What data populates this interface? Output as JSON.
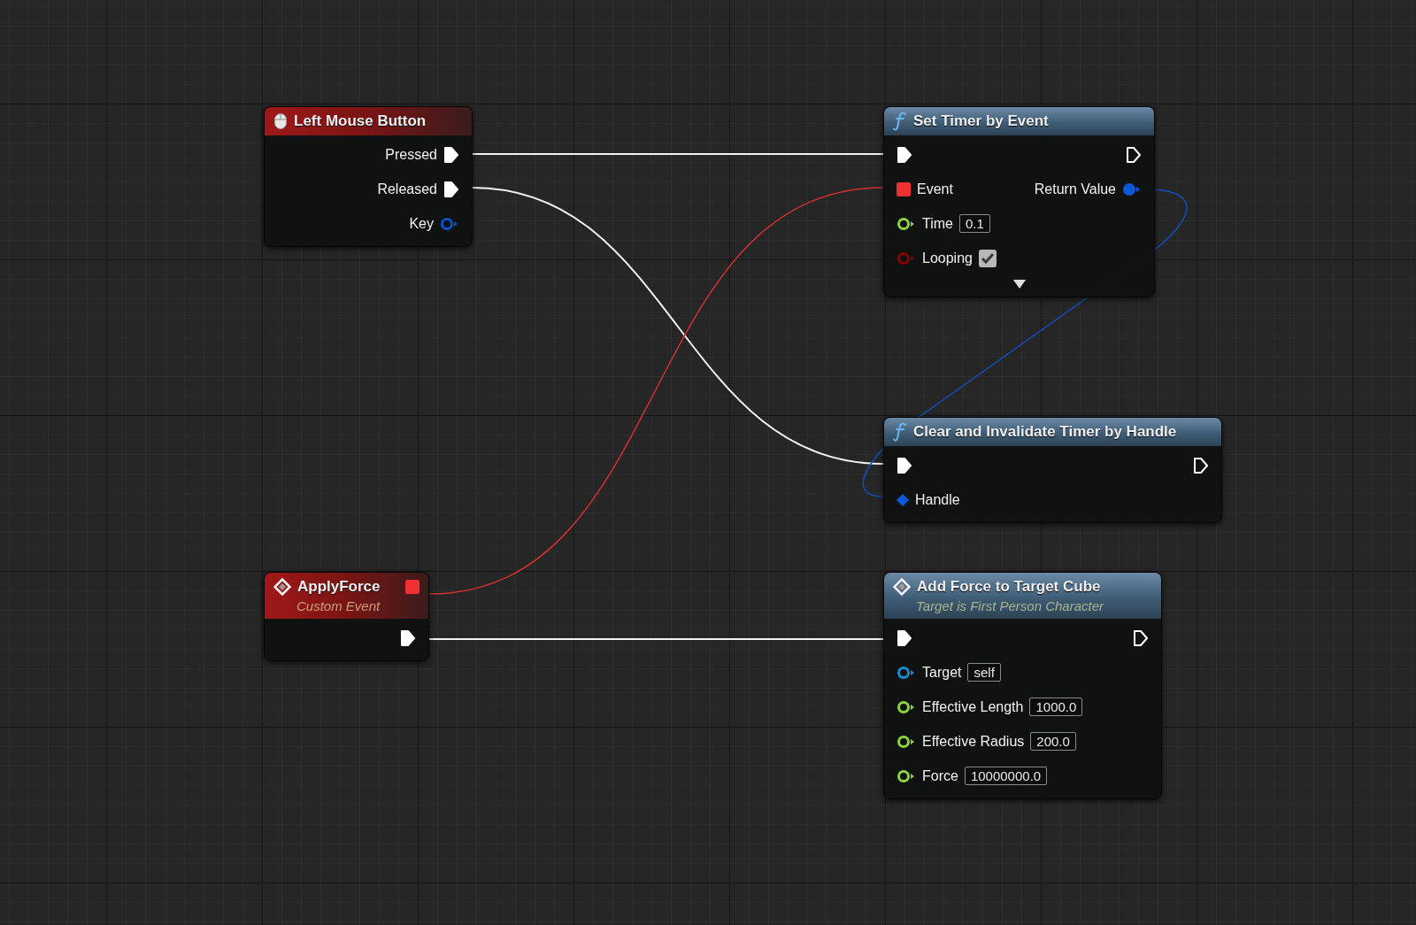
{
  "nodes": [
    {
      "kind": "input_event",
      "title": "Left Mouse Button",
      "outputs": [
        {
          "kind": "exec",
          "label": "Pressed",
          "connected": true
        },
        {
          "kind": "exec",
          "label": "Released",
          "connected": true
        },
        {
          "kind": "data",
          "label": "Key",
          "connected": false,
          "color": "#0a50c8"
        }
      ]
    },
    {
      "kind": "function",
      "title": "Set Timer by Event",
      "inputs": [
        {
          "kind": "exec",
          "connected": true
        },
        {
          "kind": "delegate",
          "label": "Event",
          "connected": true,
          "color": "#f03030"
        },
        {
          "kind": "data",
          "label": "Time",
          "connected": false,
          "color": "#8cd43a",
          "value": "0.1"
        },
        {
          "kind": "bool",
          "label": "Looping",
          "connected": false,
          "color": "#8a0000",
          "checked": true
        }
      ],
      "outputs": [
        {
          "kind": "exec",
          "connected": false
        },
        {
          "kind": "data",
          "label": "Return Value",
          "connected": true,
          "color": "#0a5ad8"
        }
      ],
      "advanced": true
    },
    {
      "kind": "function",
      "title": "Clear and Invalidate Timer by Handle",
      "inputs": [
        {
          "kind": "exec",
          "connected": true
        },
        {
          "kind": "struct",
          "label": "Handle",
          "connected": true,
          "color": "#0a5ad8"
        }
      ],
      "outputs": [
        {
          "kind": "exec",
          "connected": false
        }
      ]
    },
    {
      "kind": "custom_event",
      "title": "ApplyForce",
      "subtitle": "Custom Event",
      "header_pin": {
        "kind": "delegate",
        "connected": true,
        "color": "#f03030"
      },
      "outputs": [
        {
          "kind": "exec",
          "connected": true
        }
      ]
    },
    {
      "kind": "function_event",
      "title": "Add Force to Target Cube",
      "subtitle": "Target is First Person Character",
      "inputs": [
        {
          "kind": "exec",
          "connected": true
        },
        {
          "kind": "data",
          "label": "Target",
          "connected": false,
          "color": "#1a8ad8",
          "value": "self"
        },
        {
          "kind": "data",
          "label": "Effective Length",
          "connected": false,
          "color": "#8cd43a",
          "value": "1000.0"
        },
        {
          "kind": "data",
          "label": "Effective Radius",
          "connected": false,
          "color": "#8cd43a",
          "value": "200.0"
        },
        {
          "kind": "data",
          "label": "Force",
          "connected": false,
          "color": "#8cd43a",
          "value": "10000000.0"
        }
      ],
      "outputs": [
        {
          "kind": "exec",
          "connected": false
        }
      ]
    }
  ]
}
